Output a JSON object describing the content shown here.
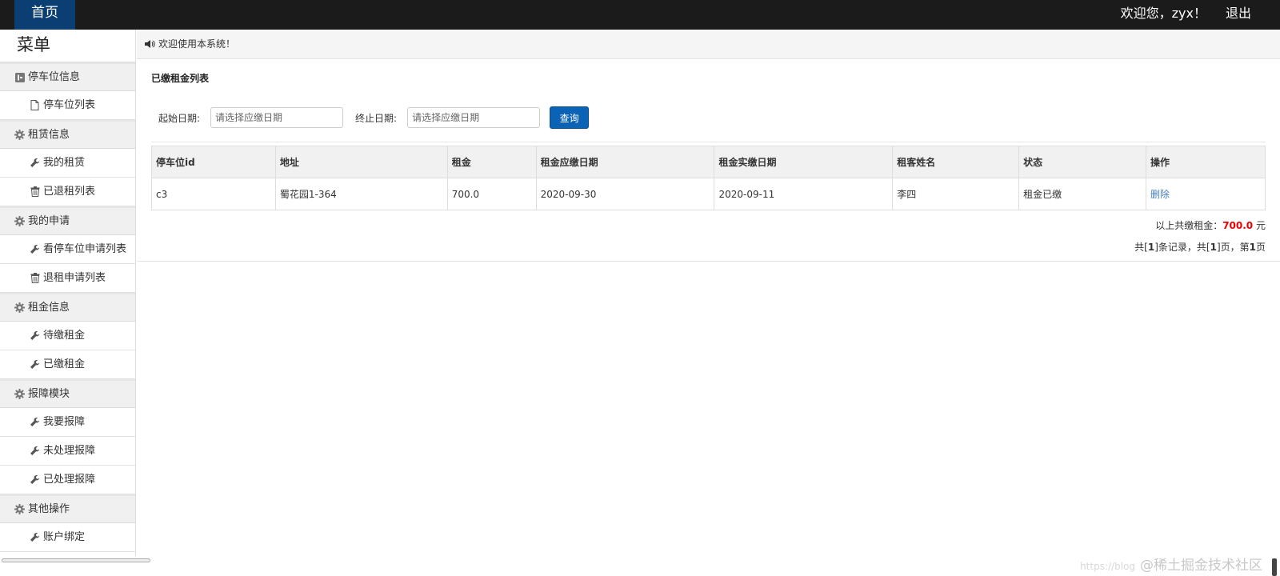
{
  "topbar": {
    "home_label": "首页",
    "welcome": "欢迎您，zyx！",
    "logout": "退出"
  },
  "sidebar": {
    "title": "菜单",
    "groups": [
      {
        "label": "停车位信息",
        "icon": "square-icon",
        "items": [
          {
            "label": "停车位列表",
            "icon": "file-icon"
          }
        ]
      },
      {
        "label": "租赁信息",
        "icon": "gear-icon",
        "items": [
          {
            "label": "我的租赁",
            "icon": "wrench-icon"
          },
          {
            "label": "已退租列表",
            "icon": "trash-icon"
          }
        ]
      },
      {
        "label": "我的申请",
        "icon": "gear-icon",
        "items": [
          {
            "label": "看停车位申请列表",
            "icon": "wrench-icon"
          },
          {
            "label": "退租申请列表",
            "icon": "trash-icon"
          }
        ]
      },
      {
        "label": "租金信息",
        "icon": "gear-icon",
        "items": [
          {
            "label": "待缴租金",
            "icon": "wrench-icon"
          },
          {
            "label": "已缴租金",
            "icon": "wrench-icon"
          }
        ]
      },
      {
        "label": "报障模块",
        "icon": "gear-icon",
        "items": [
          {
            "label": "我要报障",
            "icon": "wrench-icon"
          },
          {
            "label": "未处理报障",
            "icon": "wrench-icon"
          },
          {
            "label": "已处理报障",
            "icon": "wrench-icon"
          }
        ]
      },
      {
        "label": "其他操作",
        "icon": "gear-icon",
        "items": [
          {
            "label": "账户绑定",
            "icon": "wrench-icon"
          }
        ]
      }
    ]
  },
  "notice": {
    "text": "欢迎使用本系统！",
    "icon": "speaker-icon"
  },
  "panel": {
    "title": "已缴租金列表"
  },
  "search": {
    "start_label": "起始日期:",
    "start_placeholder": "请选择应缴日期",
    "end_label": "终止日期:",
    "end_placeholder": "请选择应缴日期",
    "button": "查询"
  },
  "table": {
    "headers": [
      "停车位id",
      "地址",
      "租金",
      "租金应缴日期",
      "租金实缴日期",
      "租客姓名",
      "状态",
      "操作"
    ],
    "rows": [
      [
        "c3",
        "蜀花园1-364",
        "700.0",
        "2020-09-30",
        "2020-09-11",
        "李四",
        "租金已缴",
        "删除"
      ]
    ]
  },
  "summary": {
    "prefix": "以上共缴租金：",
    "amount": "700.0",
    "suffix": " 元"
  },
  "pager": {
    "p1": "共[",
    "total": "1",
    "p2": "]条记录，共[",
    "pages": "1",
    "p3": "]页，第",
    "current": "1",
    "p4": "页"
  },
  "watermark": {
    "small": "https://blog",
    "text": "@稀土掘金技术社区"
  },
  "colors": {
    "topbar": "#1b1b1b",
    "home_tab": "#0b3f74",
    "button": "#0b63b5",
    "amount": "#e00000",
    "link": "#4a7fc1"
  }
}
